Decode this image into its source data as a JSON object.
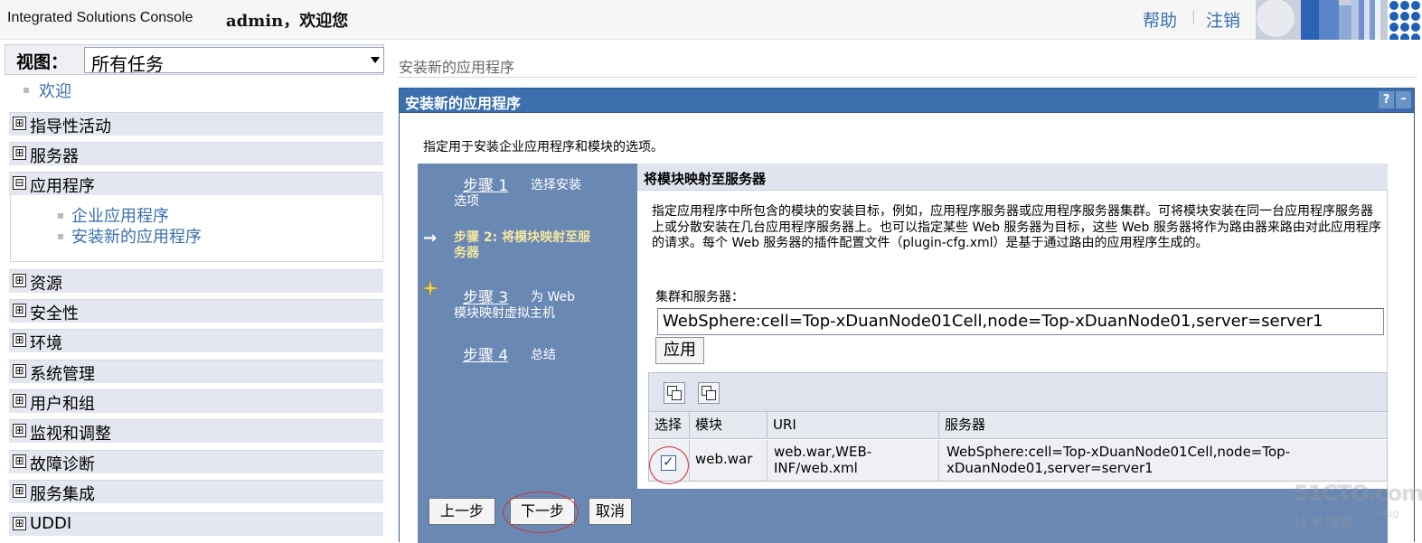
{
  "header": {
    "product_name": "Integrated Solutions Console",
    "welcome": "admin，欢迎您",
    "help_link": "帮助",
    "separator": "|",
    "logout_link": "注销"
  },
  "nav": {
    "view_label": "视图：",
    "view_select_value": "所有任务",
    "welcome_link": "欢迎",
    "categories": [
      {
        "label": "指导性活动",
        "expander": "⊞"
      },
      {
        "label": "服务器",
        "expander": "⊞"
      },
      {
        "label": "应用程序",
        "expander": "⊟"
      },
      {
        "label": "资源",
        "expander": "⊞"
      },
      {
        "label": "安全性",
        "expander": "⊞"
      },
      {
        "label": "环境",
        "expander": "⊞"
      },
      {
        "label": "系统管理",
        "expander": "⊞"
      },
      {
        "label": "用户和组",
        "expander": "⊞"
      },
      {
        "label": "监视和调整",
        "expander": "⊞"
      },
      {
        "label": "故障诊断",
        "expander": "⊞"
      },
      {
        "label": "服务集成",
        "expander": "⊞"
      },
      {
        "label": "UDDI",
        "expander": "⊞"
      }
    ],
    "app_children": [
      "企业应用程序",
      "安装新的应用程序"
    ]
  },
  "breadcrumb": "安装新的应用程序",
  "portlet": {
    "title": "安装新的应用程序",
    "help_button": "?",
    "minimize_button": "–",
    "intro": "指定用于安装企业应用程序和模块的选项。"
  },
  "wizard": {
    "step1_link": "步骤 1",
    "step1_text_a": "选择安装",
    "step1_text_b": "选项",
    "step2_arrow": "→",
    "step2_text": "步骤 2: 将模块映射至服务器",
    "step3_link": "步骤 3",
    "step3_text_a": "为 Web",
    "step3_text_b": "模块映射虚拟主机",
    "step4_link": "步骤 4",
    "step4_text": "总结",
    "section_title": "将模块映射至服务器",
    "description": "指定应用程序中所包含的模块的安装目标，例如，应用程序服务器或应用程序服务器集群。可将模块安装在同一台应用程序服务器上或分散安装在几台应用程序服务器上。也可以指定某些 Web 服务器为目标，这些 Web 服务器将作为路由器来路由对此应用程序的请求。每个 Web 服务器的插件配置文件（plugin-cfg.xml）是基于通过路由的应用程序生成的。",
    "cluster_label": "集群和服务器：",
    "cluster_value": "WebSphere:cell=Top-xDuanNode01Cell,node=Top-xDuanNode01,server=server1",
    "apply_button": "应用"
  },
  "module_table": {
    "headers": [
      "选择",
      "模块",
      "URI",
      "服务器"
    ],
    "row": {
      "checked": "✓",
      "module": "web.war",
      "uri_a": "web.war,WEB-",
      "uri_b": "INF/web.xml",
      "server_a": "WebSphere:cell=Top-xDuanNode01Cell,node=Top-",
      "server_b": "xDuanNode01,server=server1"
    }
  },
  "buttons": {
    "previous": "上一步",
    "next": "下一步",
    "cancel": "取消"
  },
  "watermark": {
    "line1": "51CTO.com",
    "line2": "技术博客",
    "blog": "Blog"
  },
  "colors": {
    "accent_blue": "#3b6fae",
    "wizard_panel": "#6a88b4",
    "link_blue": "#3a6fb0",
    "highlight_red": "#d03030"
  }
}
